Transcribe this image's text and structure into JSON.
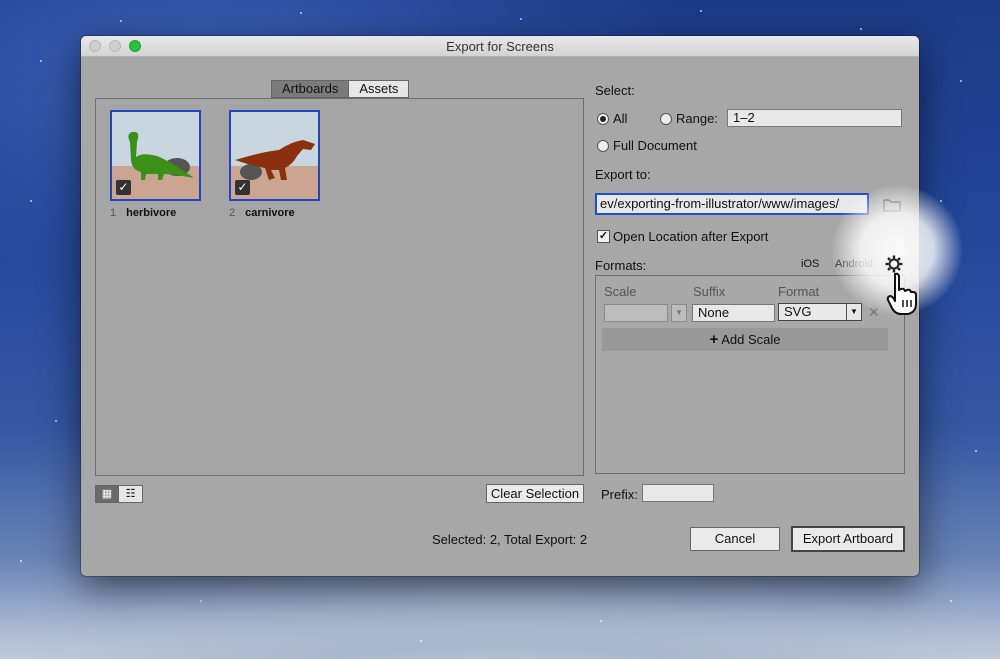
{
  "window": {
    "title": "Export for Screens"
  },
  "tabs": [
    {
      "label": "Artboards",
      "active": true
    },
    {
      "label": "Assets",
      "active": false
    }
  ],
  "artboards": [
    {
      "number": "1",
      "name": "herbivore",
      "checked": true
    },
    {
      "number": "2",
      "name": "carnivore",
      "checked": true
    }
  ],
  "view_buttons": [
    {
      "icon": "grid-view-icon",
      "active": true
    },
    {
      "icon": "list-view-icon",
      "active": false
    }
  ],
  "clear_selection_label": "Clear Selection",
  "select": {
    "label": "Select:",
    "all_label": "All",
    "range_label": "Range:",
    "range_value": "1–2",
    "full_document_label": "Full Document",
    "selected_option": "All"
  },
  "export_to": {
    "label": "Export to:",
    "path": "ev/exporting-from-illustrator/www/images/",
    "open_location_label": "Open Location after Export",
    "open_location_checked": true
  },
  "formats": {
    "label": "Formats:",
    "ios_label": "iOS",
    "android_label": "Android",
    "columns": {
      "scale": "Scale",
      "suffix": "Suffix",
      "format": "Format"
    },
    "row": {
      "scale": "",
      "suffix": "None",
      "format": "SVG"
    },
    "add_scale_label": "Add Scale"
  },
  "prefix_label": "Prefix:",
  "prefix_value": "",
  "status_text": "Selected: 2, Total Export: 2",
  "cancel_label": "Cancel",
  "export_label": "Export Artboard"
}
